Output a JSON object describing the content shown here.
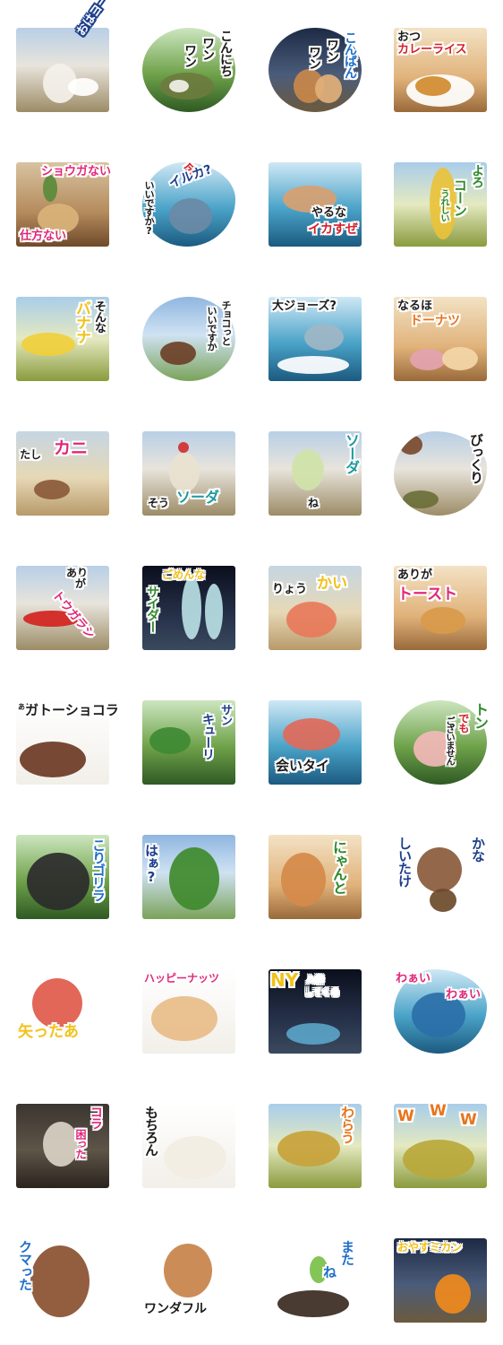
{
  "stickers": [
    {
      "id": "good-morning-yogurt",
      "captions": [
        "おはヨーグルト"
      ]
    },
    {
      "id": "hello-wanwan",
      "captions": [
        "こんにち",
        "ワン",
        "ワン"
      ]
    },
    {
      "id": "good-evening-wanwan",
      "captions": [
        "こんばん",
        "ワン",
        "ワン"
      ]
    },
    {
      "id": "snack-curry-rice",
      "captions": [
        "おつ",
        "カレーライス"
      ]
    },
    {
      "id": "ginger-no-help",
      "captions": [
        "ショウガない",
        "仕方ない"
      ]
    },
    {
      "id": "dolphin-ok-now",
      "captions": [
        "今",
        "イルカ?",
        "いいですか?"
      ]
    },
    {
      "id": "squid-well-done",
      "captions": [
        "やるな",
        "イカすぜ"
      ]
    },
    {
      "id": "corn-regards",
      "captions": [
        "よろ",
        "コーン",
        "うれしい"
      ]
    },
    {
      "id": "banana-no-way",
      "captions": [
        "そんな",
        "バナナ"
      ]
    },
    {
      "id": "chocolate-a-bit",
      "captions": [
        "チョコっと",
        "いいですか"
      ]
    },
    {
      "id": "jaws-ok",
      "captions": [
        "大ジョーズ?"
      ]
    },
    {
      "id": "donut-i-see",
      "captions": [
        "なるほ",
        "ドーナツ"
      ]
    },
    {
      "id": "crab-certainly",
      "captions": [
        "たし",
        "カニ"
      ]
    },
    {
      "id": "soda-ice-float",
      "captions": [
        "そう",
        "ソーダ"
      ]
    },
    {
      "id": "soda-melon",
      "captions": [
        "ソーダ",
        "ね"
      ]
    },
    {
      "id": "chestnut-surprise",
      "captions": [
        "びっくり"
      ]
    },
    {
      "id": "chili-thanks",
      "captions": [
        "あり",
        "が",
        "トウガラシ"
      ]
    },
    {
      "id": "cider-sorry",
      "captions": [
        "ごめんな",
        "サイダー"
      ]
    },
    {
      "id": "shell-roger",
      "captions": [
        "りょう",
        "かい"
      ]
    },
    {
      "id": "toast-thanks",
      "captions": [
        "ありが",
        "トースト"
      ]
    },
    {
      "id": "gateau-chocolat-thanks",
      "captions": [
        "あり",
        "ガトーショコラ"
      ]
    },
    {
      "id": "cucumber-thanks",
      "captions": [
        "サン",
        "キューリ"
      ]
    },
    {
      "id": "sea-bream-want-meet",
      "captions": [
        "会いタイ"
      ]
    },
    {
      "id": "pig-not-at-all",
      "captions": [
        "トン",
        "でも",
        "ございません"
      ]
    },
    {
      "id": "gorilla-fed-up",
      "captions": [
        "こりゴリラ"
      ]
    },
    {
      "id": "leaf-huh",
      "captions": [
        "はぁ?"
      ]
    },
    {
      "id": "cat-nyanto",
      "captions": [
        "にゃんと"
      ]
    },
    {
      "id": "shiitake-is-it",
      "captions": [
        "かな",
        "しいたけ"
      ]
    },
    {
      "id": "arrow-oops",
      "captions": [
        "矢ったあ"
      ]
    },
    {
      "id": "peanut-happy-nuts",
      "captions": [
        "ハッピーナッツ"
      ]
    },
    {
      "id": "ny-bath",
      "captions": [
        "NY",
        "入浴",
        "してくる"
      ]
    },
    {
      "id": "wave-wow",
      "captions": [
        "わぁい",
        "わぁい"
      ]
    },
    {
      "id": "coffee-troubled",
      "captions": [
        "コラ",
        "困った"
      ]
    },
    {
      "id": "mochi-of-course",
      "captions": [
        "もちろん"
      ]
    },
    {
      "id": "straw-laugh",
      "captions": [
        "わらう"
      ]
    },
    {
      "id": "rice-www",
      "captions": [
        "W",
        "W",
        "W"
      ]
    },
    {
      "id": "bear-troubled",
      "captions": [
        "クマった"
      ]
    },
    {
      "id": "dog-wonderful",
      "captions": [
        "ワンダフル"
      ]
    },
    {
      "id": "sprout-see-you",
      "captions": [
        "また",
        "ね"
      ]
    },
    {
      "id": "mandarin-good-night",
      "captions": [
        "おやすミカン"
      ]
    }
  ],
  "colors": {
    "red": "#d4212b",
    "magenta": "#e0287a",
    "navy": "#1d3f8a",
    "blue": "#1f6fc8",
    "teal": "#1a9a9e",
    "green": "#2f8a2c",
    "yellow": "#f1c21b",
    "orange": "#e8741c",
    "black": "#1b1b1b",
    "white": "#ffffff"
  }
}
